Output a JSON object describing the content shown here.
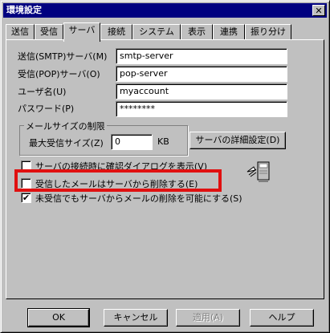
{
  "window": {
    "title": "環境設定",
    "close_glyph": "✕"
  },
  "tabs": [
    {
      "label": "送信"
    },
    {
      "label": "受信"
    },
    {
      "label": "サーバ"
    },
    {
      "label": "接続"
    },
    {
      "label": "システム"
    },
    {
      "label": "表示"
    },
    {
      "label": "連携"
    },
    {
      "label": "振り分け"
    }
  ],
  "active_tab": "サーバ",
  "server": {
    "smtp_label": "送信(SMTP)サーバ(M)",
    "smtp_value": "smtp-server",
    "pop_label": "受信(POP)サーバ(O)",
    "pop_value": "pop-server",
    "user_label": "ユーザ名(U)",
    "user_value": "myaccount",
    "password_label": "パスワード(P)",
    "password_value": "********"
  },
  "mail_size": {
    "group_title": "メールサイズの制限",
    "max_label": "最大受信サイズ(Z)",
    "max_value": "0",
    "unit": "KB",
    "detail_button": "サーバの詳細設定(D)"
  },
  "options": [
    {
      "label": "サーバの接続時に確認ダイアログを表示(V)",
      "checked": false
    },
    {
      "label": "受信したメールはサーバから削除する(E)",
      "checked": false,
      "highlighted": true
    },
    {
      "label": "未受信でもサーバからメールの削除を可能にする(S)",
      "checked": true
    }
  ],
  "icon": "mail-server-icon",
  "highlight_color": "#e01010",
  "buttons": {
    "ok": "OK",
    "cancel": "キャンセル",
    "apply": "適用(A)",
    "help": "ヘルプ"
  }
}
